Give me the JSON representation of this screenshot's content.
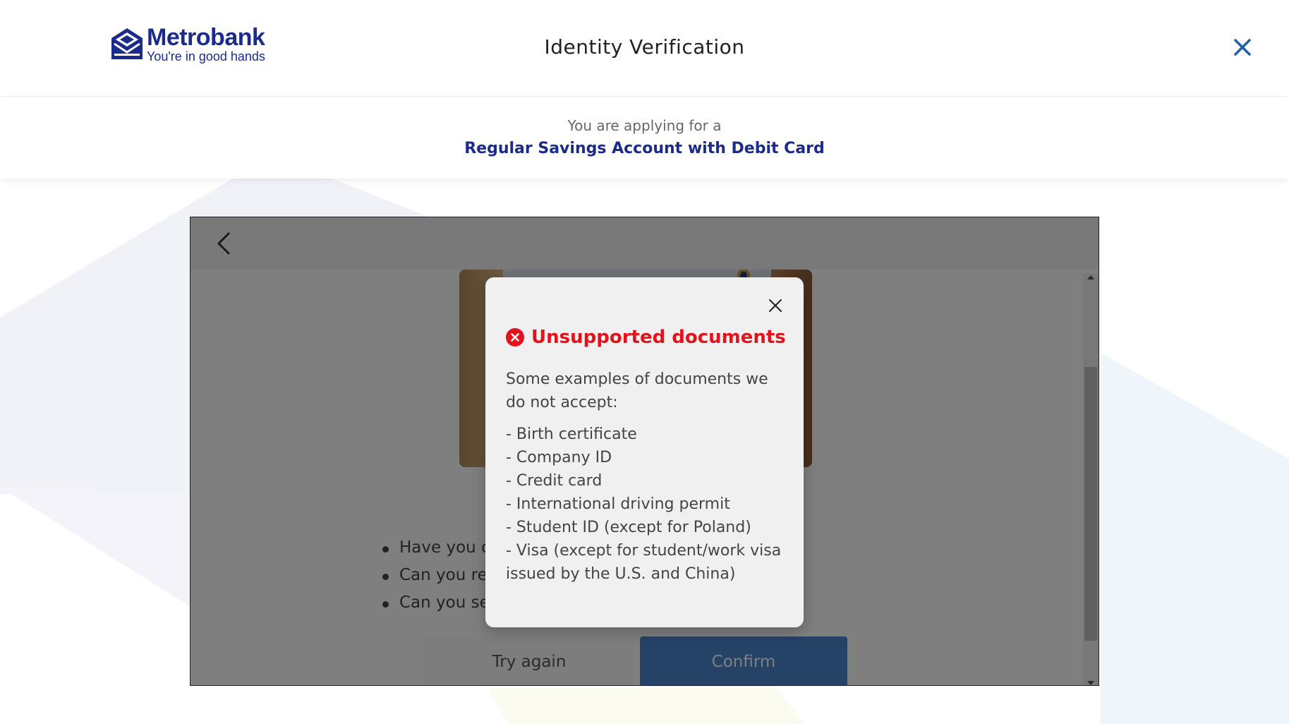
{
  "header": {
    "brand_name": "Metrobank",
    "brand_tagline": "You're in good hands",
    "title": "Identity Verification",
    "close_icon": "close-icon"
  },
  "application": {
    "applying_label": "You are applying for a",
    "product_name": "Regular Savings Account with Debit Card"
  },
  "verification": {
    "back_icon": "chevron-left-icon",
    "checklist": [
      "Have you cl",
      "Can you rea",
      "Can you see"
    ],
    "try_again_label": "Try again",
    "confirm_label": "Confirm"
  },
  "modal": {
    "icon": "error-icon",
    "title": "Unsupported documents",
    "intro": "Some examples of documents we do not accept:",
    "items": [
      "- Birth certificate",
      "- Company ID",
      "- Credit card",
      "- International driving permit",
      "- Student ID (except for Poland)",
      "- Visa (except for student/work visa issued by the U.S. and China)"
    ]
  },
  "colors": {
    "brand": "#1a2b8c",
    "error": "#e3121b",
    "close_icon": "#1f5fa8",
    "confirm": "#4a86cf"
  }
}
